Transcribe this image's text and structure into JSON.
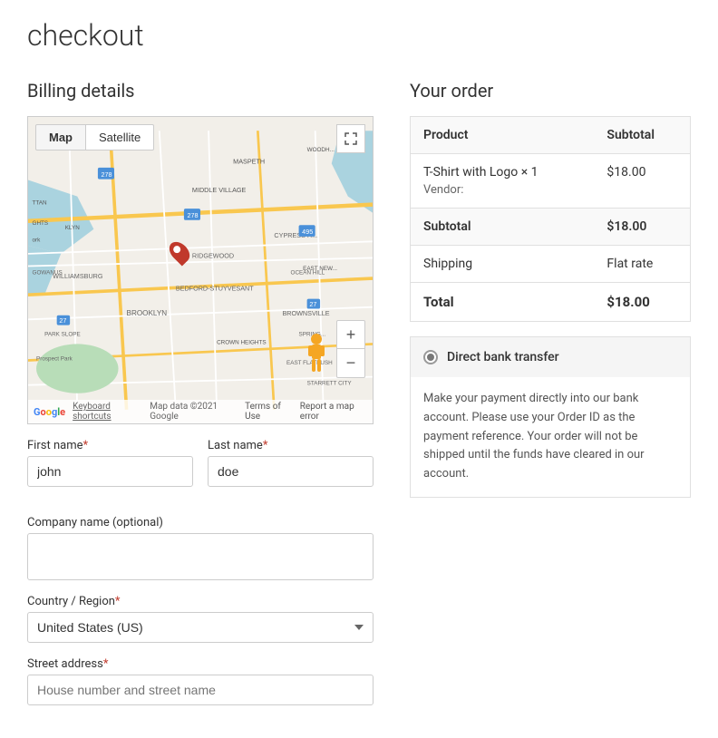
{
  "page": {
    "title": "checkout"
  },
  "billing": {
    "section_title": "Billing details",
    "map": {
      "map_btn": "Map",
      "satellite_btn": "Satellite",
      "keyboard_shortcuts": "Keyboard shortcuts",
      "map_data": "Map data ©2021 Google",
      "terms_of_use": "Terms of Use",
      "report_error": "Report a map error"
    },
    "fields": {
      "first_name_label": "First name",
      "first_name_placeholder": "john",
      "last_name_label": "Last name",
      "last_name_placeholder": "doe",
      "company_label": "Company name (optional)",
      "company_placeholder": "",
      "country_label": "Country / Region",
      "country_required": true,
      "country_value": "United States (US)",
      "street_label": "Street address",
      "street_required": true,
      "street_placeholder": "House number and street name",
      "required_marker": "*"
    }
  },
  "order": {
    "section_title": "Your order",
    "table": {
      "col_product": "Product",
      "col_subtotal": "Subtotal",
      "rows": [
        {
          "product": "T-Shirt with Logo × 1",
          "vendor_label": "Vendor:",
          "vendor_value": "",
          "subtotal": "$18.00"
        }
      ],
      "subtotal_label": "Subtotal",
      "subtotal_value": "$18.00",
      "shipping_label": "Shipping",
      "shipping_value": "Flat rate",
      "total_label": "Total",
      "total_value": "$18.00"
    },
    "payment": {
      "option_label": "Direct bank transfer",
      "description": "Make your payment directly into our bank account. Please use your Order ID as the payment reference. Your order will not be shipped until the funds have cleared in our account."
    }
  }
}
